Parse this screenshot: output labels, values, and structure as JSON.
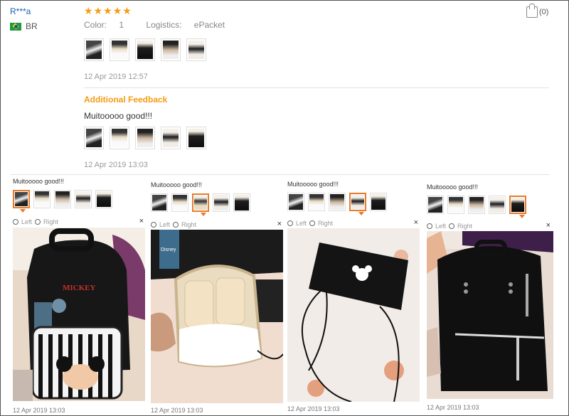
{
  "review": {
    "user": "R***a",
    "country": "BR",
    "stars": [
      "★",
      "★",
      "★",
      "★",
      "★"
    ],
    "color_label": "Color:",
    "color_value": "1",
    "logistics_label": "Logistics:",
    "logistics_value": "ePacket",
    "likes": "(0)",
    "first_timestamp": "12 Apr 2019 12:57",
    "additional_label": "Additional Feedback",
    "feedback_text": "Muitooooo good!!!",
    "second_timestamp": "12 Apr 2019 13:03"
  },
  "photo_panels": [
    {
      "text": "Muitooooo good!!!",
      "left": "Left",
      "right": "Right",
      "close": "×",
      "date": "12 Apr 2019 13:03"
    },
    {
      "text": "Muitooooo good!!!",
      "left": "Left",
      "right": "Right",
      "close": "×",
      "date": "12 Apr 2019 13:03"
    },
    {
      "text": "Muitooooo good!!!",
      "left": "Left",
      "right": "Right",
      "close": "×",
      "date": "12 Apr 2019 13:03"
    },
    {
      "text": "Muitooooo good!!!",
      "left": "Left",
      "right": "Right",
      "close": "×",
      "date": "12 Apr 2019 13:03"
    }
  ],
  "photo_labels": {
    "mickey_text": "MICKEY",
    "brand_tag": "Disney"
  },
  "colors": {
    "star": "#f39c12",
    "user_link": "#1a5fb4",
    "accent": "#e87b2b"
  },
  "icons": [
    "brazil-flag-icon",
    "star-icon",
    "thumbs-up-icon",
    "rotate-left-icon",
    "rotate-right-icon",
    "close-icon"
  ]
}
